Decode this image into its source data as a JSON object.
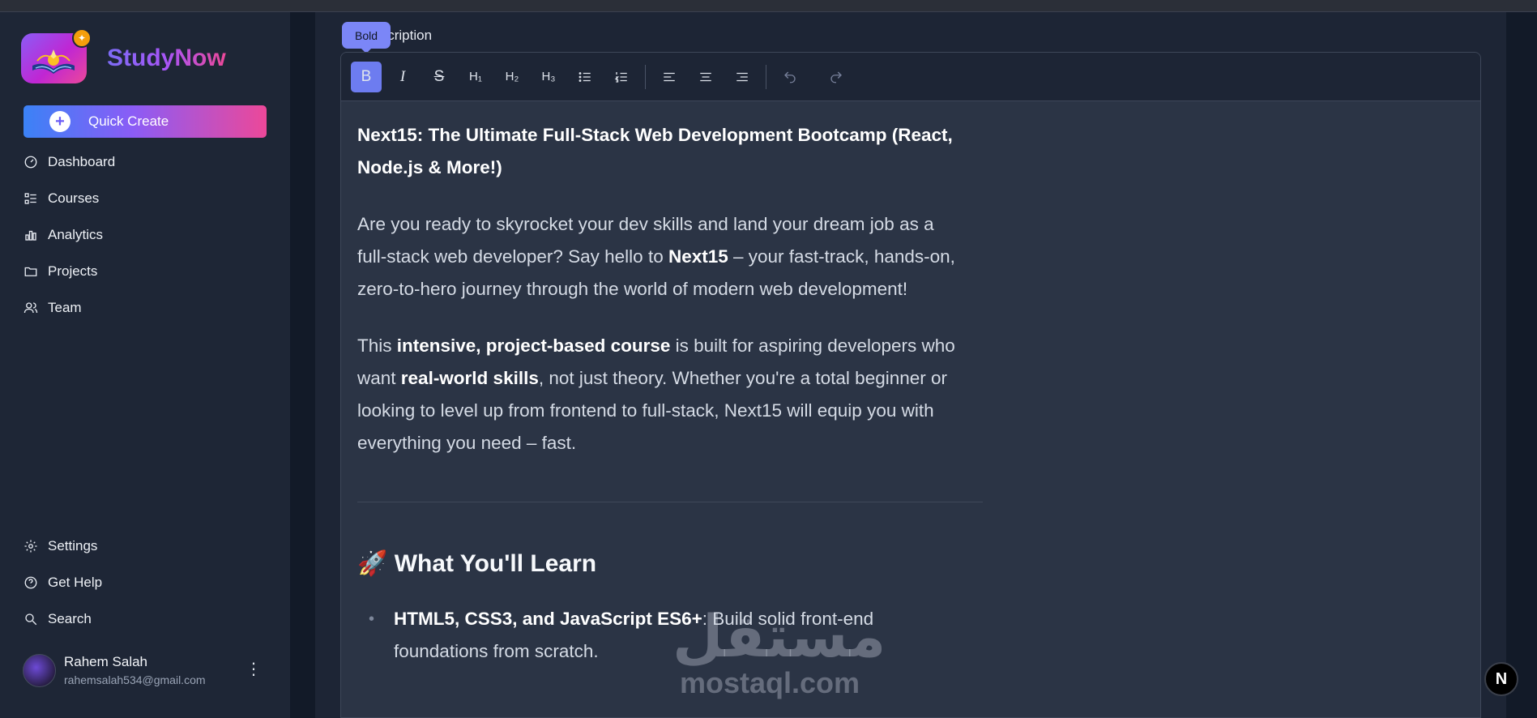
{
  "brand": {
    "name": "StudyNow"
  },
  "sidebar": {
    "quick_create": "Quick Create",
    "nav": [
      {
        "label": "Dashboard",
        "icon": "dashboard-icon"
      },
      {
        "label": "Courses",
        "icon": "list-icon"
      },
      {
        "label": "Analytics",
        "icon": "chart-icon"
      },
      {
        "label": "Projects",
        "icon": "folder-icon"
      },
      {
        "label": "Team",
        "icon": "users-icon"
      }
    ],
    "bottom_nav": [
      {
        "label": "Settings",
        "icon": "gear-icon"
      },
      {
        "label": "Get Help",
        "icon": "help-icon"
      },
      {
        "label": "Search",
        "icon": "search-icon"
      }
    ],
    "user": {
      "name": "Rahem Salah",
      "email": "rahemsalah534@gmail.com"
    }
  },
  "editor": {
    "field_label": "Description",
    "tooltip": "Bold",
    "toolbar": {
      "bold": "B",
      "italic": "I",
      "strike": "S",
      "h1": "H₁",
      "h2": "H₂",
      "h3": "H₃"
    },
    "content": {
      "title": "Next15: The Ultimate Full-Stack Web Development Bootcamp (React, Node.js & More!)",
      "p1_a": "Are you ready to skyrocket your dev skills and land your dream job as a full-stack web developer? Say hello to ",
      "p1_b": "Next15",
      "p1_c": " – your fast-track, hands-on, zero-to-hero journey through the world of modern web development!",
      "p2_a": "This ",
      "p2_b": "intensive, project-based course",
      "p2_c": " is built for aspiring developers who want ",
      "p2_d": "real-world skills",
      "p2_e": ", not just theory. Whether you're a total beginner or looking to level up from frontend to full-stack, Next15 will equip you with everything you need – fast.",
      "h2": "🚀 What You'll Learn",
      "li1_a": "HTML5, CSS3, and JavaScript ES6+",
      "li1_b": ": Build solid front-end foundations from scratch."
    }
  },
  "watermark": {
    "arabic": "مستقل",
    "latin": "mostaql.com"
  },
  "next_badge": "N"
}
